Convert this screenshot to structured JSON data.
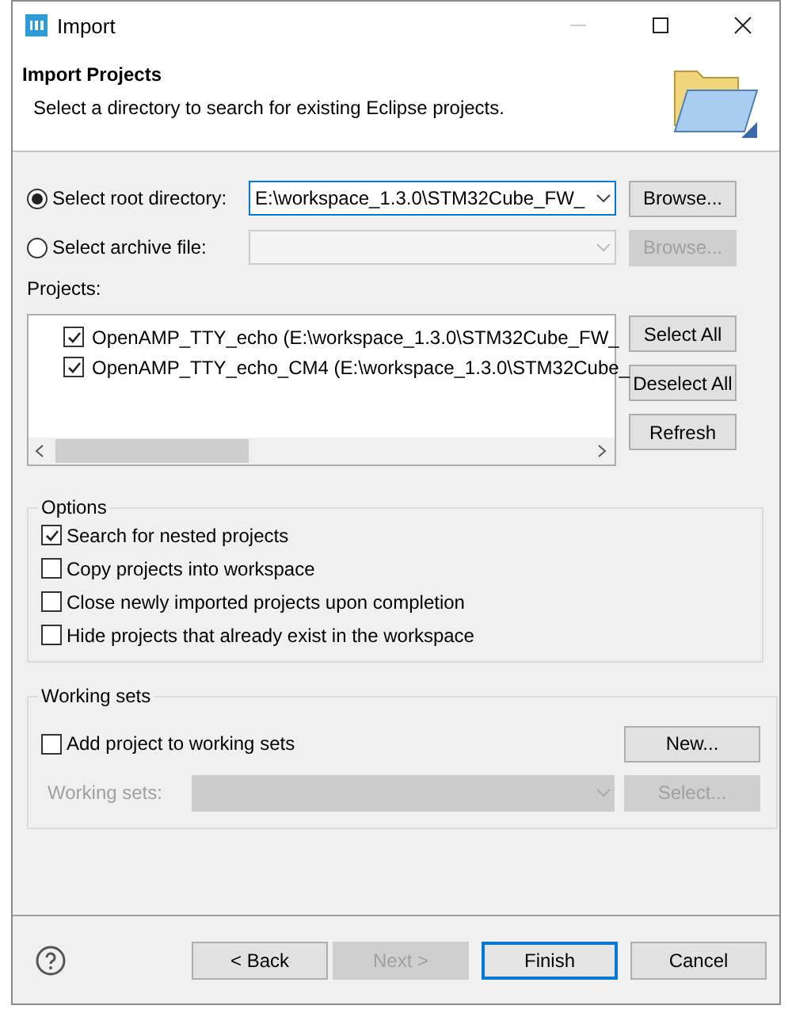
{
  "window": {
    "title": "Import"
  },
  "header": {
    "title": "Import Projects",
    "description": "Select a directory to search for existing Eclipse projects."
  },
  "sources": [
    {
      "label": "Select root directory:",
      "selected": true,
      "disabled": false,
      "value": "E:\\workspace_1.3.0\\STM32Cube_FW_",
      "button": "Browse...",
      "button_disabled": false
    },
    {
      "label": "Select archive file:",
      "selected": false,
      "disabled": true,
      "button": "Browse...",
      "button_disabled": true
    }
  ],
  "projects": {
    "label": "Projects:",
    "items": [
      {
        "label": "OpenAMP_TTY_echo (E:\\workspace_1.3.0\\STM32Cube_FW_",
        "checked": true
      },
      {
        "label": "OpenAMP_TTY_echo_CM4 (E:\\workspace_1.3.0\\STM32Cube_",
        "checked": true
      }
    ],
    "buttons": [
      "Select All",
      "Deselect All",
      "Refresh"
    ]
  },
  "options": {
    "title": "Options",
    "items": [
      {
        "label": "Search for nested projects",
        "checked": true
      },
      {
        "label": "Copy projects into workspace",
        "checked": false
      },
      {
        "label": "Close newly imported projects upon completion",
        "checked": false
      },
      {
        "label": "Hide projects that already exist in the workspace",
        "checked": false
      }
    ]
  },
  "working_sets": {
    "title": "Working sets",
    "add": {
      "label": "Add project to working sets",
      "checked": false
    },
    "new_button": "New...",
    "field_label": "Working sets:",
    "disabled": true,
    "select_button": "Select..."
  },
  "footer_buttons": [
    {
      "label": "< Back",
      "disabled": false,
      "default": false
    },
    {
      "label": "Next >",
      "disabled": true,
      "default": false
    },
    {
      "label": "Finish",
      "disabled": false,
      "default": true
    },
    {
      "label": "Cancel",
      "disabled": false,
      "default": false
    }
  ]
}
